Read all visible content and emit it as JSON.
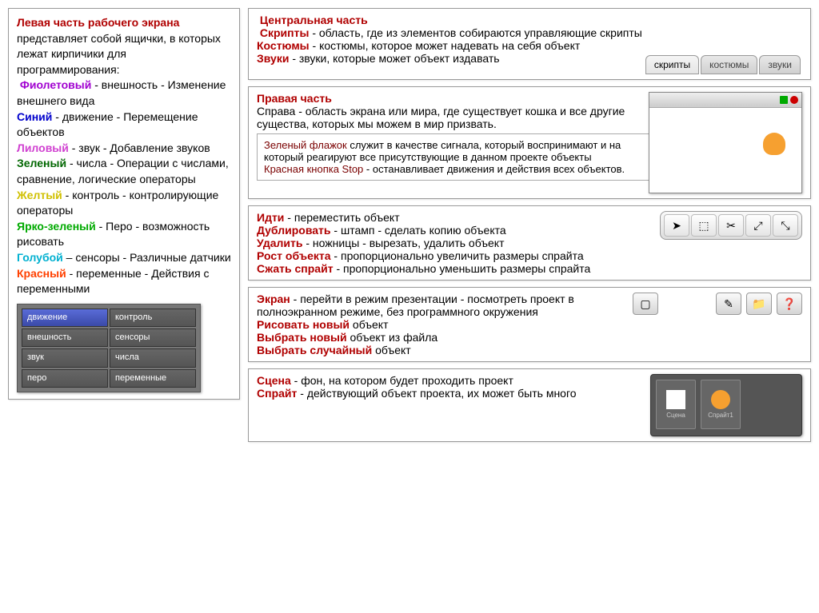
{
  "left": {
    "title": "Левая часть рабочего экрана",
    "title_tail": " представляет собой ящички, в которых лежат кирпичики для программирования:",
    "items": [
      {
        "name": "Фиолетовый",
        "cls": "bold-purple",
        "desc": " - внешность - Изменение внешнего вида"
      },
      {
        "name": "Синий",
        "cls": "bold-blue",
        "desc": " - движение - Перемещение объектов"
      },
      {
        "name": "Лиловый",
        "cls": "bold-magenta",
        "desc": " - звук - Добавление звуков"
      },
      {
        "name": "Зеленый",
        "cls": "bold-darkgreen",
        "desc": " - числа - Операции с числами, сравнение, логические операторы"
      },
      {
        "name": "Желтый",
        "cls": "bold-yellow",
        "desc": " - контроль - контролирующие операторы"
      },
      {
        "name": "Ярко-зеленый",
        "cls": "bold-brightgreen",
        "desc": " - Перо - возможность рисовать"
      },
      {
        "name": "Голубой",
        "cls": "bold-cyan",
        "desc": " – сенсоры - Различные датчики"
      },
      {
        "name": "Красный",
        "cls": "bold-orange",
        "desc": " - переменные - Действия с переменными"
      }
    ],
    "palette": {
      "rows": [
        [
          "движение",
          "контроль"
        ],
        [
          "внешность",
          "сенсоры"
        ],
        [
          "звук",
          "числа"
        ],
        [
          "перо",
          "переменные"
        ]
      ]
    }
  },
  "center": {
    "header": "Центральная часть",
    "scripts_label": "Скрипты",
    "scripts_desc": " - область, где из элементов собираются управляющие скрипты",
    "costumes_label": "Костюмы",
    "costumes_desc": " - костюмы, которое может надевать на себя объект",
    "sounds_label": "Звуки",
    "sounds_desc": " - звуки, которые может объект издавать",
    "tabs": [
      "скрипты",
      "костюмы",
      "звуки"
    ]
  },
  "right": {
    "header": "Правая часть",
    "desc": "Справа - область экрана или мира, где существует кошка и все другие существа, которых мы можем в мир призвать.",
    "green_flag": "Зеленый флажок",
    "green_flag_desc": " служит в качестве сигнала, который воспринимают и на который реагируют все присутствующие в данном проекте объекты",
    "red_stop": "Красная кнопка Stop",
    "red_stop_desc": " - останавливает движения и действия всех объектов."
  },
  "tools": {
    "go": "Идти",
    "go_d": " - переместить объект",
    "dup": "Дублировать",
    "dup_d": " - штамп - сделать копию объекта",
    "del": "Удалить",
    "del_d": " - ножницы - вырезать, удалить объект",
    "grow": "Рост объекта",
    "grow_d": " - пропорционально увеличить размеры спрайта",
    "shrink": "Сжать спрайт",
    "shrink_d": " - пропорционально уменьшить размеры спрайта"
  },
  "screen": {
    "screen": "Экран",
    "screen_d": " - перейти в режим презентации - посмотреть проект в полноэкранном режиме, без программного окружения",
    "draw": "Рисовать новый",
    "draw_d": " объект",
    "choose": "Выбрать новый",
    "choose_d": " объект из файла",
    "random": "Выбрать случайный",
    "random_d": " объект"
  },
  "sprites": {
    "scene": "Сцена",
    "scene_d": " - фон, на котором будет проходить проект",
    "sprite": "Спрайт",
    "sprite_d": " - действующий объект проекта, их может быть много",
    "slot1": "Сцена",
    "slot2": "Спрайт1"
  }
}
